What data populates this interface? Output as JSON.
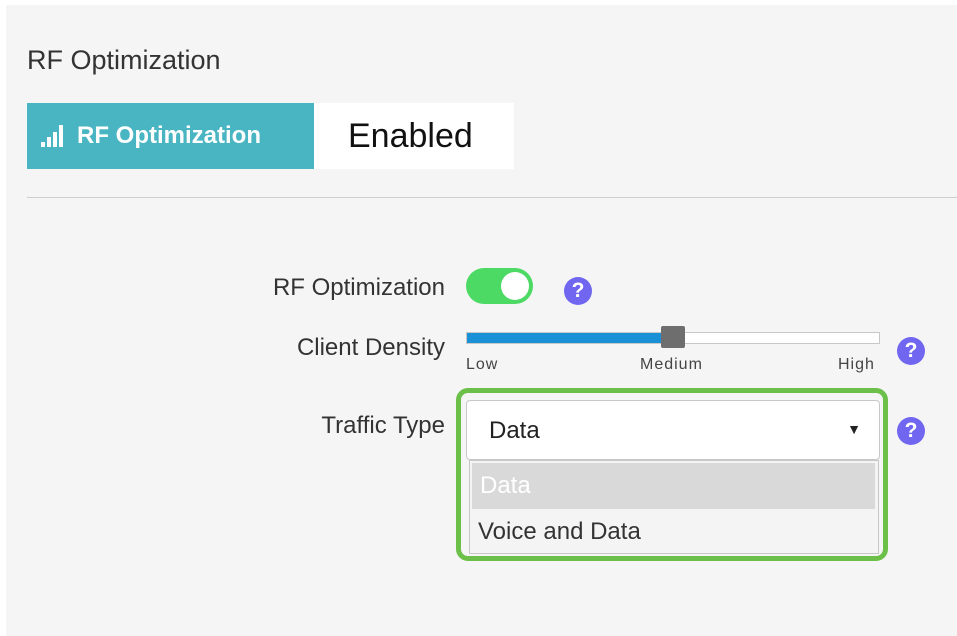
{
  "header": {
    "title": "RF Optimization"
  },
  "summary": {
    "badge_icon": "signal-bars-icon",
    "badge_label": "RF Optimization",
    "status": "Enabled",
    "badge_color": "#49b5c2"
  },
  "form": {
    "rf_optimization": {
      "label": "RF Optimization",
      "enabled": true,
      "help": "?",
      "toggle_color": "#4cd964"
    },
    "client_density": {
      "label": "Client Density",
      "level_fraction": 0.5,
      "ticks": [
        "Low",
        "Medium",
        "High"
      ],
      "help": "?",
      "fill_color": "#1a90d6"
    },
    "traffic_type": {
      "label": "Traffic Type",
      "selected": "Data",
      "options": [
        "Data",
        "Voice and Data"
      ],
      "help": "?",
      "highlight_color": "#6cc04a"
    }
  }
}
